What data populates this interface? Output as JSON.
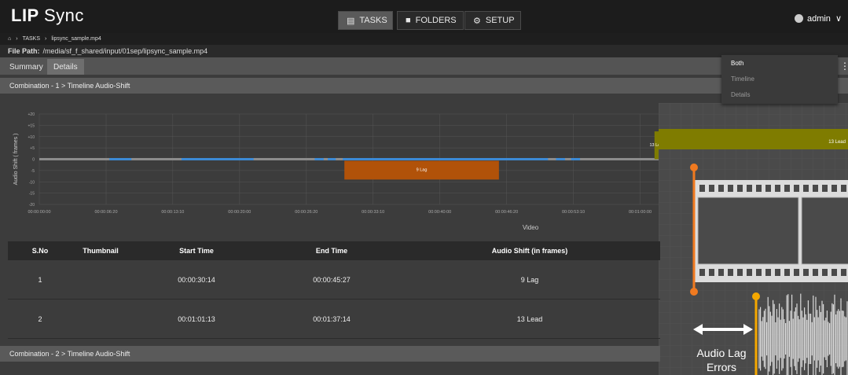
{
  "app": {
    "logo_main": "LIP",
    "logo_sync": "Sync"
  },
  "nav": {
    "tasks": "TASKS",
    "folders": "FOLDERS",
    "setup": "SETUP"
  },
  "user": {
    "name": "admin"
  },
  "breadcrumb": {
    "tasks": "TASKS",
    "file": "lipsync_sample.mp4"
  },
  "file_path": {
    "label": "File Path:",
    "value": "/media/sf_f_shared/input/01sep/lipsync_sample.mp4"
  },
  "tabs": {
    "summary": "Summary",
    "details": "Details"
  },
  "menu": {
    "items": [
      "Both",
      "Timeline",
      "Details"
    ]
  },
  "combination1": {
    "title": "Combination - 1 > Timeline Audio-Shift"
  },
  "combination2": {
    "title": "Combination - 2 > Timeline Audio-Shift"
  },
  "chart_data": {
    "type": "area",
    "ylabel": "Audio Shift ( frames )",
    "xlabel": "Video",
    "y_ticks": [
      "20",
      "15",
      "10",
      "5",
      "0",
      "-5",
      "-10",
      "-15",
      "-20"
    ],
    "ylim": [
      -20,
      20
    ],
    "x_ticks": [
      "00:00:00:00",
      "00:00:06:20",
      "00:00:13:10",
      "00:00:20:00",
      "00:00:26:20",
      "00:00:33:10",
      "00:00:40:00",
      "00:00:46:20",
      "00:00:53:10",
      "00:01:00:00"
    ],
    "x_tick_seconds": [
      0,
      6.67,
      13.33,
      20,
      26.67,
      33.33,
      40,
      46.67,
      53.33,
      60
    ],
    "x_visible_max_s": 62,
    "segments": [
      {
        "label": "9 Lag",
        "start": "00:00:30:14",
        "end": "00:00:45:27",
        "value": -9,
        "color": "#b15209"
      },
      {
        "label": "13 Lead",
        "start": "00:01:01:13",
        "end": "00:01:37:14",
        "value": 13,
        "color": "#7f7c00"
      }
    ],
    "baseline_color": "#8c8c8c",
    "detection_color": "#3c8ad6",
    "detections": [
      [
        7.0,
        9.2
      ],
      [
        14.2,
        21.4
      ],
      [
        27.5,
        28.4
      ],
      [
        28.8,
        29.6
      ],
      [
        30.3,
        50.8
      ],
      [
        51.6,
        52.5
      ],
      [
        53.1,
        54.0
      ]
    ]
  },
  "table": {
    "headers": [
      "S.No",
      "Thumbnail",
      "Start Time",
      "End Time",
      "Audio Shift (in frames)"
    ],
    "rows": [
      [
        "1",
        "",
        "00:00:30:14",
        "00:00:45:27",
        "9 Lag"
      ],
      [
        "2",
        "",
        "00:01:01:13",
        "00:01:37:14",
        "13 Lead"
      ]
    ]
  },
  "overlay": {
    "label_line1": "Audio Lag",
    "label_line2": "Errors",
    "accent": "#f07a20"
  }
}
